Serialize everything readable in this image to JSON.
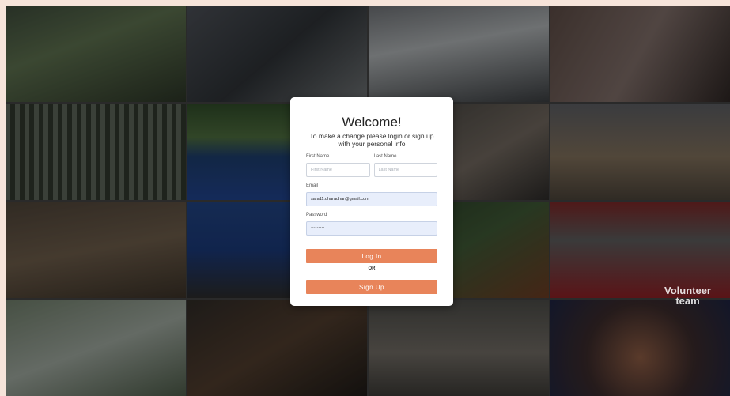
{
  "login": {
    "title": "Welcome!",
    "subtitle": "To make a change please login or sign up with your personal info",
    "first_name_label": "First Name",
    "first_name_placeholder": "First Name",
    "last_name_label": "Last Name",
    "last_name_placeholder": "Last Name",
    "email_label": "Email",
    "email_value": "sara11.dharadhar@gmail.com",
    "password_label": "Password",
    "password_value": "•••••••••",
    "login_button": "Log In",
    "or_text": "OR",
    "signup_button": "Sign Up"
  },
  "background": {
    "overlay_line1": "Volunteer",
    "overlay_line2": "team"
  },
  "colors": {
    "accent": "#e8845a",
    "page_bg": "#f6e4da"
  }
}
